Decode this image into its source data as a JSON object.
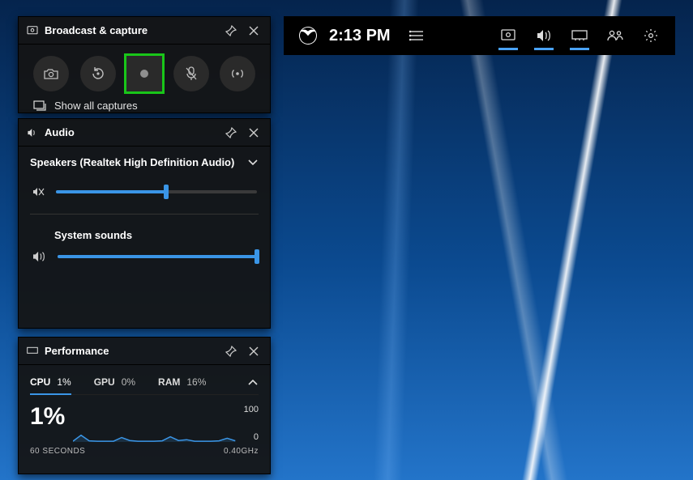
{
  "topbar": {
    "time": "2:13 PM",
    "buttons": {
      "menu": "menu",
      "capture": "capture",
      "audio": "audio",
      "performance": "performance",
      "social": "social",
      "settings": "settings"
    }
  },
  "broadcast": {
    "title": "Broadcast & capture",
    "buttons": {
      "screenshot": "screenshot",
      "record_last": "record-last-30s",
      "record": "start-recording",
      "mic": "mic-off",
      "broadcast": "start-broadcast"
    },
    "show_all_label": "Show all captures"
  },
  "audio": {
    "title": "Audio",
    "device_label": "Speakers (Realtek High Definition Audio)",
    "mixer": {
      "master": {
        "muted": true,
        "value": 48,
        "label": ""
      },
      "system": {
        "label": "System sounds",
        "value": 100,
        "muted": false
      }
    }
  },
  "performance": {
    "title": "Performance",
    "tabs": {
      "cpu": {
        "label": "CPU",
        "value": "1%"
      },
      "gpu": {
        "label": "GPU",
        "value": "0%"
      },
      "ram": {
        "label": "RAM",
        "value": "16%"
      }
    },
    "active_tab": "cpu",
    "big_value": "1%",
    "y_max": "100",
    "y_min": "0",
    "x_label": "60 SECONDS",
    "freq_label": "0.40GHz"
  },
  "chart_data": {
    "type": "line",
    "title": "CPU usage",
    "xlabel": "60 SECONDS",
    "ylabel": "%",
    "ylim": [
      0,
      100
    ],
    "x": [
      0,
      3,
      6,
      9,
      12,
      15,
      18,
      21,
      24,
      27,
      30,
      33,
      36,
      39,
      42,
      45,
      48,
      51,
      54,
      57,
      60
    ],
    "values": [
      2,
      18,
      3,
      2,
      2,
      2,
      12,
      4,
      2,
      2,
      2,
      3,
      14,
      4,
      6,
      2,
      2,
      2,
      3,
      10,
      3
    ]
  }
}
